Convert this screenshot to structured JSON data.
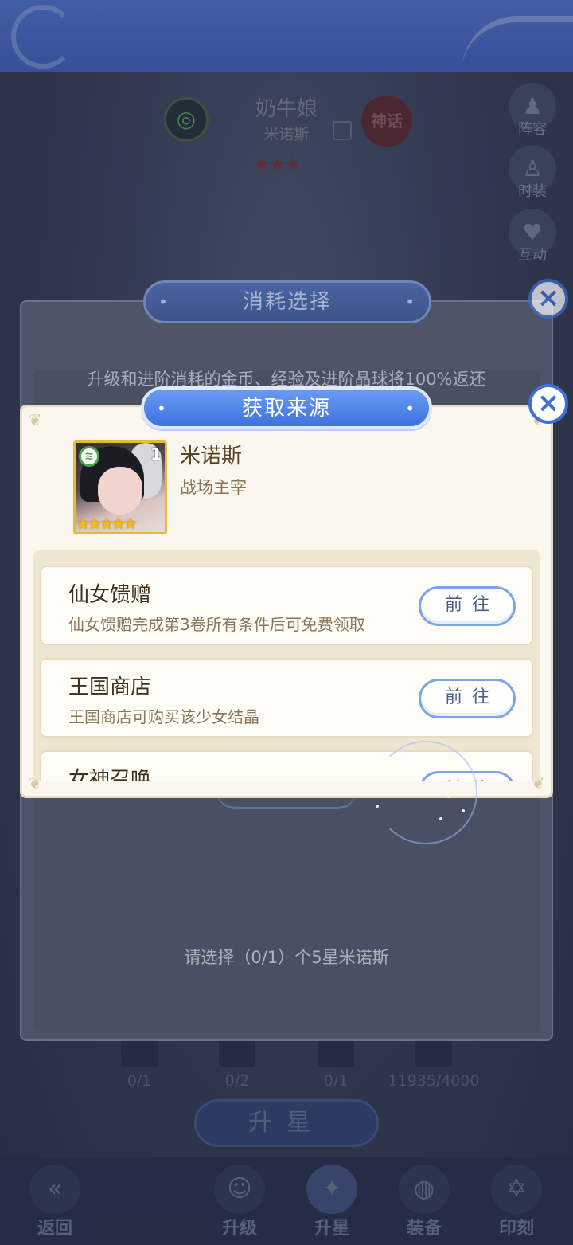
{
  "hero": {
    "name": "奶牛娘",
    "subtitle": "米诺斯",
    "stars": "★★★",
    "faction_icon": "faction-wind-icon",
    "type_badge": "神话"
  },
  "side_menu": [
    {
      "label": "阵容",
      "icon": "person-icon"
    },
    {
      "label": "时装",
      "icon": "dress-icon"
    },
    {
      "label": "互动",
      "icon": "heart-icon"
    }
  ],
  "costs": [
    {
      "value": "0/1"
    },
    {
      "value": "0/2"
    },
    {
      "value": "0/1"
    },
    {
      "value": "11935/4000"
    }
  ],
  "upstar_button": "升星",
  "nav": [
    {
      "label": "返回",
      "icon": "back-icon"
    },
    {
      "label": "升级",
      "icon": "portrait-icon"
    },
    {
      "label": "升星",
      "icon": "star-icon"
    },
    {
      "label": "装备",
      "icon": "equipment-icon"
    },
    {
      "label": "印刻",
      "icon": "hexagram-icon"
    }
  ],
  "consume_dialog": {
    "title": "消耗选择",
    "description": "升级和进阶消耗的金币、经验及进阶晶球将100%返还",
    "select_hint": "请选择（0/1）个5星米诺斯",
    "close": "×"
  },
  "source_dialog": {
    "title": "获取来源",
    "close": "×",
    "item": {
      "name": "米诺斯",
      "description": "战场主宰",
      "level": "1",
      "stars": "★★★★★",
      "faction_icon": "faction-wind-icon"
    },
    "sources": [
      {
        "name": "仙女馈赠",
        "description": "仙女馈赠完成第3卷所有条件后可免费领取",
        "button": "前往"
      },
      {
        "name": "王国商店",
        "description": "王国商店可购买该少女结晶",
        "button": "前往"
      },
      {
        "name": "女神召唤",
        "description": "",
        "button": "前往"
      }
    ]
  }
}
